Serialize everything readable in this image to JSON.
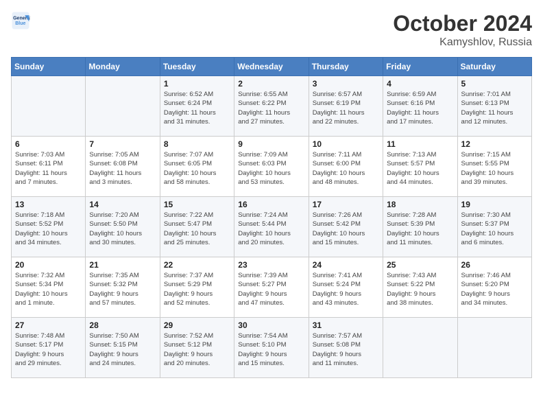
{
  "header": {
    "logo_line1": "General",
    "logo_line2": "Blue",
    "month": "October 2024",
    "location": "Kamyshlov, Russia"
  },
  "weekdays": [
    "Sunday",
    "Monday",
    "Tuesday",
    "Wednesday",
    "Thursday",
    "Friday",
    "Saturday"
  ],
  "weeks": [
    [
      {
        "day": "",
        "info": ""
      },
      {
        "day": "",
        "info": ""
      },
      {
        "day": "1",
        "info": "Sunrise: 6:52 AM\nSunset: 6:24 PM\nDaylight: 11 hours\nand 31 minutes."
      },
      {
        "day": "2",
        "info": "Sunrise: 6:55 AM\nSunset: 6:22 PM\nDaylight: 11 hours\nand 27 minutes."
      },
      {
        "day": "3",
        "info": "Sunrise: 6:57 AM\nSunset: 6:19 PM\nDaylight: 11 hours\nand 22 minutes."
      },
      {
        "day": "4",
        "info": "Sunrise: 6:59 AM\nSunset: 6:16 PM\nDaylight: 11 hours\nand 17 minutes."
      },
      {
        "day": "5",
        "info": "Sunrise: 7:01 AM\nSunset: 6:13 PM\nDaylight: 11 hours\nand 12 minutes."
      }
    ],
    [
      {
        "day": "6",
        "info": "Sunrise: 7:03 AM\nSunset: 6:11 PM\nDaylight: 11 hours\nand 7 minutes."
      },
      {
        "day": "7",
        "info": "Sunrise: 7:05 AM\nSunset: 6:08 PM\nDaylight: 11 hours\nand 3 minutes."
      },
      {
        "day": "8",
        "info": "Sunrise: 7:07 AM\nSunset: 6:05 PM\nDaylight: 10 hours\nand 58 minutes."
      },
      {
        "day": "9",
        "info": "Sunrise: 7:09 AM\nSunset: 6:03 PM\nDaylight: 10 hours\nand 53 minutes."
      },
      {
        "day": "10",
        "info": "Sunrise: 7:11 AM\nSunset: 6:00 PM\nDaylight: 10 hours\nand 48 minutes."
      },
      {
        "day": "11",
        "info": "Sunrise: 7:13 AM\nSunset: 5:57 PM\nDaylight: 10 hours\nand 44 minutes."
      },
      {
        "day": "12",
        "info": "Sunrise: 7:15 AM\nSunset: 5:55 PM\nDaylight: 10 hours\nand 39 minutes."
      }
    ],
    [
      {
        "day": "13",
        "info": "Sunrise: 7:18 AM\nSunset: 5:52 PM\nDaylight: 10 hours\nand 34 minutes."
      },
      {
        "day": "14",
        "info": "Sunrise: 7:20 AM\nSunset: 5:50 PM\nDaylight: 10 hours\nand 30 minutes."
      },
      {
        "day": "15",
        "info": "Sunrise: 7:22 AM\nSunset: 5:47 PM\nDaylight: 10 hours\nand 25 minutes."
      },
      {
        "day": "16",
        "info": "Sunrise: 7:24 AM\nSunset: 5:44 PM\nDaylight: 10 hours\nand 20 minutes."
      },
      {
        "day": "17",
        "info": "Sunrise: 7:26 AM\nSunset: 5:42 PM\nDaylight: 10 hours\nand 15 minutes."
      },
      {
        "day": "18",
        "info": "Sunrise: 7:28 AM\nSunset: 5:39 PM\nDaylight: 10 hours\nand 11 minutes."
      },
      {
        "day": "19",
        "info": "Sunrise: 7:30 AM\nSunset: 5:37 PM\nDaylight: 10 hours\nand 6 minutes."
      }
    ],
    [
      {
        "day": "20",
        "info": "Sunrise: 7:32 AM\nSunset: 5:34 PM\nDaylight: 10 hours\nand 1 minute."
      },
      {
        "day": "21",
        "info": "Sunrise: 7:35 AM\nSunset: 5:32 PM\nDaylight: 9 hours\nand 57 minutes."
      },
      {
        "day": "22",
        "info": "Sunrise: 7:37 AM\nSunset: 5:29 PM\nDaylight: 9 hours\nand 52 minutes."
      },
      {
        "day": "23",
        "info": "Sunrise: 7:39 AM\nSunset: 5:27 PM\nDaylight: 9 hours\nand 47 minutes."
      },
      {
        "day": "24",
        "info": "Sunrise: 7:41 AM\nSunset: 5:24 PM\nDaylight: 9 hours\nand 43 minutes."
      },
      {
        "day": "25",
        "info": "Sunrise: 7:43 AM\nSunset: 5:22 PM\nDaylight: 9 hours\nand 38 minutes."
      },
      {
        "day": "26",
        "info": "Sunrise: 7:46 AM\nSunset: 5:20 PM\nDaylight: 9 hours\nand 34 minutes."
      }
    ],
    [
      {
        "day": "27",
        "info": "Sunrise: 7:48 AM\nSunset: 5:17 PM\nDaylight: 9 hours\nand 29 minutes."
      },
      {
        "day": "28",
        "info": "Sunrise: 7:50 AM\nSunset: 5:15 PM\nDaylight: 9 hours\nand 24 minutes."
      },
      {
        "day": "29",
        "info": "Sunrise: 7:52 AM\nSunset: 5:12 PM\nDaylight: 9 hours\nand 20 minutes."
      },
      {
        "day": "30",
        "info": "Sunrise: 7:54 AM\nSunset: 5:10 PM\nDaylight: 9 hours\nand 15 minutes."
      },
      {
        "day": "31",
        "info": "Sunrise: 7:57 AM\nSunset: 5:08 PM\nDaylight: 9 hours\nand 11 minutes."
      },
      {
        "day": "",
        "info": ""
      },
      {
        "day": "",
        "info": ""
      }
    ]
  ]
}
